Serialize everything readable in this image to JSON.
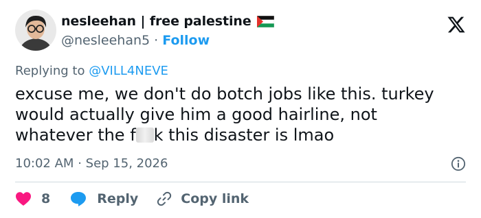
{
  "tweet": {
    "author": {
      "display_name": "nesleehan | free palestine",
      "handle": "@nesleehan5",
      "separator": "·",
      "follow_label": "Follow"
    },
    "replying_to": {
      "prefix": "Replying to",
      "mention": "@VILL4NEVE"
    },
    "text_lines": [
      "excuse me, we don't do botch jobs like this. turkey",
      "would actually give him a good hairline, not"
    ],
    "text_line3_before": "whatever the f",
    "text_line3_after": "k this disaster is lmao",
    "time": "10:02 AM",
    "date_separator": "·",
    "date": "Sep 15, 2026",
    "actions": {
      "like_count": "8",
      "reply_label": "Reply",
      "copy_label": "Copy link"
    }
  },
  "colors": {
    "text": "#0f1419",
    "secondary": "#536471",
    "link": "#1d9bf0",
    "like": "#f91880",
    "divider": "#cfd9de"
  },
  "icons": [
    "palestine-flag-icon",
    "x-logo-icon",
    "info-icon",
    "heart-icon",
    "reply-bubble-icon",
    "link-icon"
  ]
}
